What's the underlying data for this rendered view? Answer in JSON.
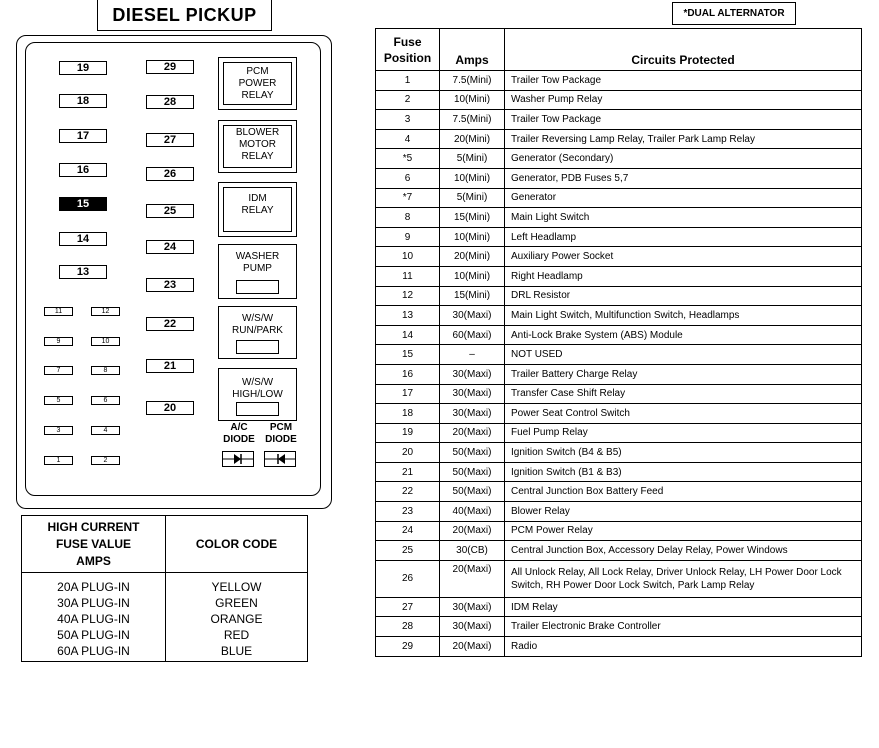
{
  "title": "DIESEL PICKUP",
  "note": "*DUAL ALTERNATOR",
  "fuse_box": {
    "col1_large": [
      "19",
      "18",
      "17",
      "16",
      "15",
      "14",
      "13"
    ],
    "highlighted_fuse": "15",
    "col2_large": [
      "29",
      "28",
      "27",
      "26",
      "25",
      "24",
      "23",
      "22",
      "21",
      "20"
    ],
    "small_left": [
      "11",
      "9",
      "7",
      "5",
      "3",
      "1"
    ],
    "small_right": [
      "12",
      "10",
      "8",
      "6",
      "4",
      "2"
    ],
    "relays": [
      {
        "label": "PCM\nPOWER\nRELAY"
      },
      {
        "label": "BLOWER\nMOTOR\nRELAY"
      },
      {
        "label": "IDM\nRELAY"
      },
      {
        "label": "WASHER\nPUMP"
      },
      {
        "label": "W/S/W\nRUN/PARK"
      },
      {
        "label": "W/S/W\nHIGH/LOW"
      }
    ],
    "diodes": [
      {
        "label": "A/C\nDIODE",
        "direction": "right"
      },
      {
        "label": "PCM\nDIODE",
        "direction": "left"
      }
    ]
  },
  "color_table": {
    "headers": [
      "HIGH CURRENT\nFUSE VALUE\nAMPS",
      "COLOR CODE"
    ],
    "rows": [
      {
        "value": "20A PLUG-IN",
        "color": "YELLOW"
      },
      {
        "value": "30A PLUG-IN",
        "color": "GREEN"
      },
      {
        "value": "40A PLUG-IN",
        "color": "ORANGE"
      },
      {
        "value": "50A PLUG-IN",
        "color": "RED"
      },
      {
        "value": "60A PLUG-IN",
        "color": "BLUE"
      }
    ]
  },
  "fuse_table": {
    "headers": [
      "Fuse\nPosition",
      "Amps",
      "Circuits Protected"
    ],
    "rows": [
      {
        "pos": "1",
        "amps": "7.5(Mini)",
        "circuit": "Trailer Tow Package"
      },
      {
        "pos": "2",
        "amps": "10(Mini)",
        "circuit": "Washer Pump Relay"
      },
      {
        "pos": "3",
        "amps": "7.5(Mini)",
        "circuit": "Trailer Tow Package"
      },
      {
        "pos": "4",
        "amps": "20(Mini)",
        "circuit": "Trailer Reversing Lamp Relay, Trailer Park Lamp Relay"
      },
      {
        "pos": "*5",
        "amps": "5(Mini)",
        "circuit": "Generator (Secondary)"
      },
      {
        "pos": "6",
        "amps": "10(Mini)",
        "circuit": "Generator, PDB Fuses 5,7"
      },
      {
        "pos": "*7",
        "amps": "5(Mini)",
        "circuit": "Generator"
      },
      {
        "pos": "8",
        "amps": "15(Mini)",
        "circuit": "Main Light Switch"
      },
      {
        "pos": "9",
        "amps": "10(Mini)",
        "circuit": "Left Headlamp"
      },
      {
        "pos": "10",
        "amps": "20(Mini)",
        "circuit": "Auxiliary Power Socket"
      },
      {
        "pos": "11",
        "amps": "10(Mini)",
        "circuit": "Right Headlamp"
      },
      {
        "pos": "12",
        "amps": "15(Mini)",
        "circuit": "DRL Resistor"
      },
      {
        "pos": "13",
        "amps": "30(Maxi)",
        "circuit": "Main Light Switch, Multifunction Switch, Headlamps"
      },
      {
        "pos": "14",
        "amps": "60(Maxi)",
        "circuit": "Anti-Lock Brake System (ABS) Module"
      },
      {
        "pos": "15",
        "amps": "–",
        "circuit": "NOT USED"
      },
      {
        "pos": "16",
        "amps": "30(Maxi)",
        "circuit": "Trailer Battery Charge Relay"
      },
      {
        "pos": "17",
        "amps": "30(Maxi)",
        "circuit": "Transfer Case Shift Relay"
      },
      {
        "pos": "18",
        "amps": "30(Maxi)",
        "circuit": "Power Seat Control Switch"
      },
      {
        "pos": "19",
        "amps": "20(Maxi)",
        "circuit": "Fuel Pump Relay"
      },
      {
        "pos": "20",
        "amps": "50(Maxi)",
        "circuit": "Ignition Switch (B4 & B5)"
      },
      {
        "pos": "21",
        "amps": "50(Maxi)",
        "circuit": "Ignition Switch (B1 & B3)"
      },
      {
        "pos": "22",
        "amps": "50(Maxi)",
        "circuit": "Central Junction Box Battery Feed"
      },
      {
        "pos": "23",
        "amps": "40(Maxi)",
        "circuit": "Blower Relay"
      },
      {
        "pos": "24",
        "amps": "20(Maxi)",
        "circuit": "PCM Power Relay"
      },
      {
        "pos": "25",
        "amps": "30(CB)",
        "circuit": "Central Junction Box, Accessory Delay Relay, Power Windows"
      },
      {
        "pos": "26",
        "amps": "20(Maxi)",
        "circuit": "All Unlock Relay, All Lock Relay, Driver Unlock Relay, LH Power Door Lock Switch, RH Power Door Lock Switch, Park Lamp Relay"
      },
      {
        "pos": "27",
        "amps": "30(Maxi)",
        "circuit": "IDM Relay"
      },
      {
        "pos": "28",
        "amps": "30(Maxi)",
        "circuit": "Trailer Electronic Brake Controller"
      },
      {
        "pos": "29",
        "amps": "20(Maxi)",
        "circuit": "Radio"
      }
    ]
  }
}
